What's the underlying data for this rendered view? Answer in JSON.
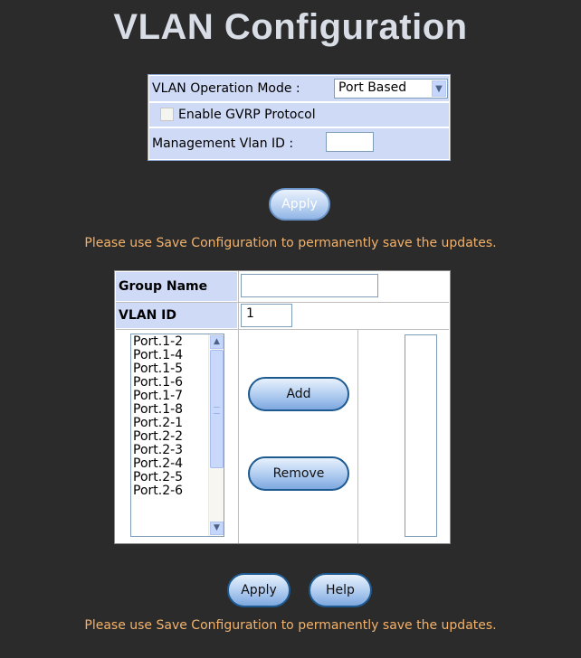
{
  "page": {
    "title": "VLAN Configuration"
  },
  "settings": {
    "mode_label": "VLAN Operation Mode :",
    "mode_value": "Port Based",
    "gvrp_label": "Enable GVRP Protocol",
    "gvrp_checked": false,
    "mgmt_label": "Management Vlan ID :",
    "mgmt_value": ""
  },
  "apply_top_label": "Apply",
  "notice": "Please use Save Configuration to permanently save the updates.",
  "vlan_form": {
    "group_name_label": "Group Name",
    "group_name_value": "",
    "vlan_id_label": "VLAN ID",
    "vlan_id_value": "1",
    "available_ports": [
      "Port.1-2",
      "Port.1-4",
      "Port.1-5",
      "Port.1-6",
      "Port.1-7",
      "Port.1-8",
      "Port.2-1",
      "Port.2-2",
      "Port.2-3",
      "Port.2-4",
      "Port.2-5",
      "Port.2-6"
    ],
    "member_ports": [],
    "add_label": "Add",
    "remove_label": "Remove"
  },
  "footer": {
    "apply_label": "Apply",
    "help_label": "Help",
    "notice": "Please use Save Configuration to permanently save the updates."
  },
  "icons": {
    "dropdown": "chevron-down-icon",
    "scroll_up": "chevron-up-icon",
    "scroll_down": "chevron-down-icon"
  }
}
